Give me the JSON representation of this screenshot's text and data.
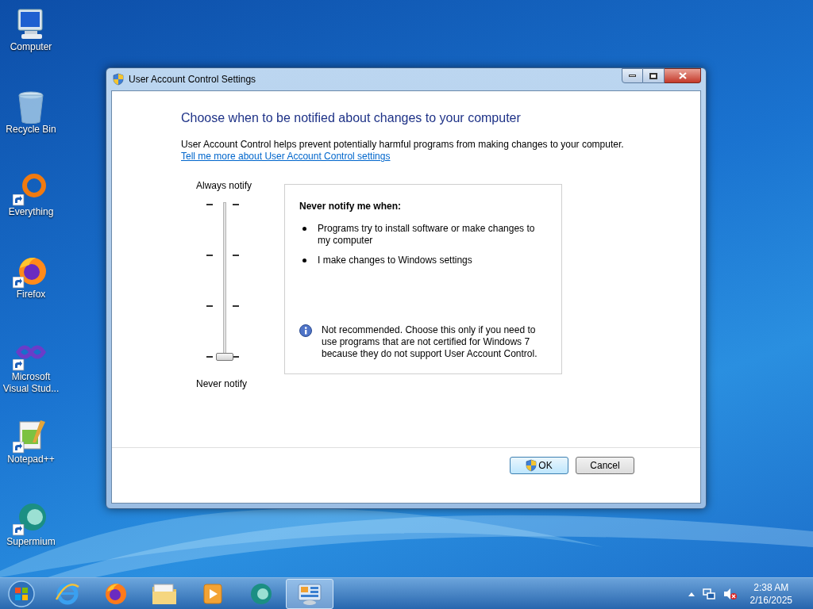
{
  "desktop_icons": [
    {
      "label": "Computer",
      "kind": "computer",
      "shortcut": false
    },
    {
      "label": "Recycle Bin",
      "kind": "recycle",
      "shortcut": false
    },
    {
      "label": "Everything",
      "kind": "everything",
      "shortcut": true
    },
    {
      "label": "Firefox",
      "kind": "firefox",
      "shortcut": true
    },
    {
      "label": "Microsoft Visual Stud...",
      "kind": "vs",
      "shortcut": true
    },
    {
      "label": "Notepad++",
      "kind": "notepad",
      "shortcut": true
    },
    {
      "label": "Supermium",
      "kind": "supermium",
      "shortcut": true
    }
  ],
  "window": {
    "title": "User Account Control Settings",
    "heading": "Choose when to be notified about changes to your computer",
    "description": "User Account Control helps prevent potentially harmful programs from making changes to your computer.",
    "link": "Tell me more about User Account Control settings",
    "slider": {
      "top_label": "Always notify",
      "bottom_label": "Never notify",
      "level": 0
    },
    "info": {
      "heading": "Never notify me when:",
      "bullets": [
        "Programs try to install software or make changes to my computer",
        "I make changes to Windows settings"
      ],
      "note": "Not recommended. Choose this only if you need to use programs that are not certified for Windows 7 because they do not support User Account Control."
    },
    "buttons": [
      {
        "label": "OK",
        "shield": true,
        "default": true
      },
      {
        "label": "Cancel",
        "shield": false,
        "default": false
      }
    ]
  },
  "taskbar": {
    "apps": [
      {
        "kind": "ie",
        "selected": false
      },
      {
        "kind": "firefox",
        "selected": false
      },
      {
        "kind": "explorer",
        "selected": false
      },
      {
        "kind": "media",
        "selected": false
      },
      {
        "kind": "supermium",
        "selected": false
      },
      {
        "kind": "control",
        "selected": true
      }
    ],
    "clock": {
      "time": "2:38 AM",
      "date": "2/16/2025"
    }
  }
}
